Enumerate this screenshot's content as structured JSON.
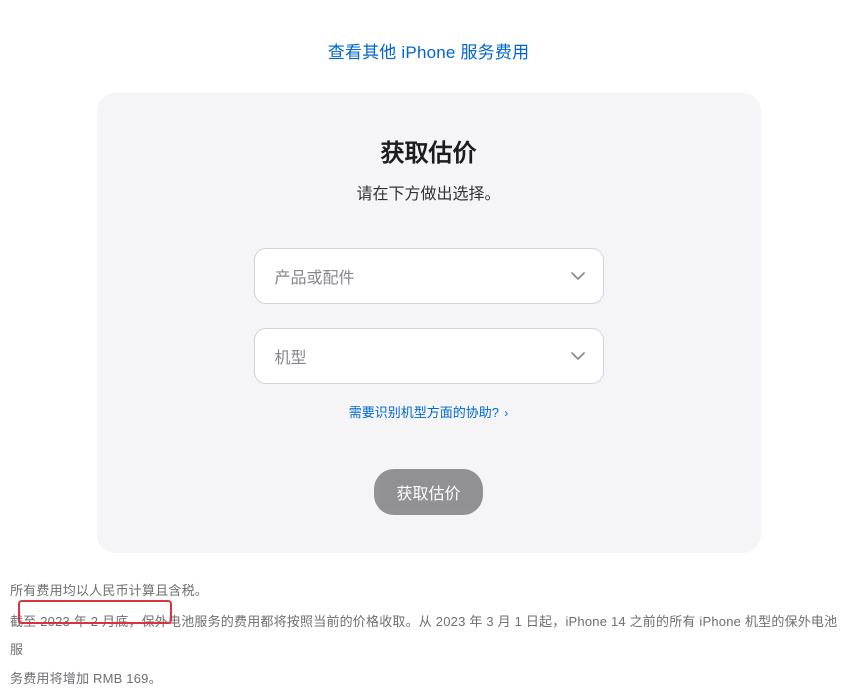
{
  "topLink": {
    "label": "查看其他 iPhone 服务费用"
  },
  "card": {
    "title": "获取估价",
    "subtitle": "请在下方做出选择。",
    "select1": {
      "placeholder": "产品或配件"
    },
    "select2": {
      "placeholder": "机型"
    },
    "helpLink": {
      "label": "需要识别机型方面的协助?"
    },
    "submit": {
      "label": "获取估价"
    }
  },
  "footnotes": {
    "line1": "所有费用均以人民币计算且含税。",
    "line2a": "截至 2023 年 2 月底，保外电池服务的费用都将按照当前的价格收取。从 2023 年 3 月 1 日起，iPhone 14 之前的所有 iPhone 机型的保外电池服",
    "line2b": "务费用将增加 RMB 169。"
  }
}
